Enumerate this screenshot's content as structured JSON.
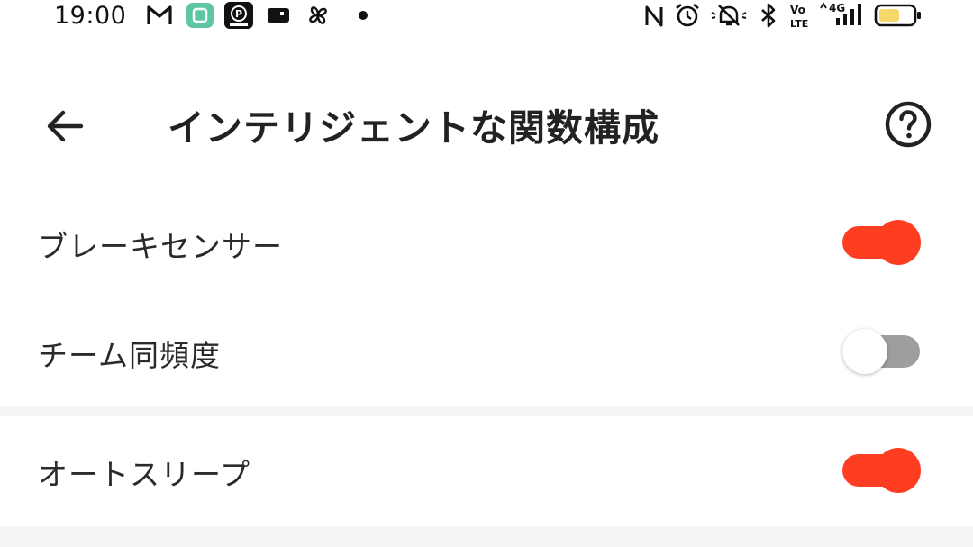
{
  "status_bar": {
    "time": "19:00",
    "icons_left": [
      "gmail-icon",
      "app-notification-icon",
      "parking-club-icon",
      "card-icon",
      "fan-icon",
      "dot-icon"
    ],
    "icons_right": [
      "nfc-icon",
      "alarm-icon",
      "mute-icon",
      "bluetooth-icon",
      "volte-icon",
      "signal-icon",
      "battery-icon"
    ],
    "network": "4G",
    "volte": [
      "Vo",
      "LTE"
    ]
  },
  "header": {
    "title": "インテリジェントな関数構成",
    "back_icon": "arrow-left-icon",
    "help_icon": "question-circle-icon"
  },
  "settings": [
    {
      "label": "ブレーキセンサー",
      "enabled": true
    },
    {
      "label": "チーム同頻度",
      "enabled": false
    },
    {
      "label": "オートスリープ",
      "enabled": true
    }
  ],
  "colors": {
    "accent": "#ff3d21",
    "toggle_off_track": "#9e9e9e",
    "divider": "#f5f5f5",
    "battery_fill": "#f7d96b"
  }
}
